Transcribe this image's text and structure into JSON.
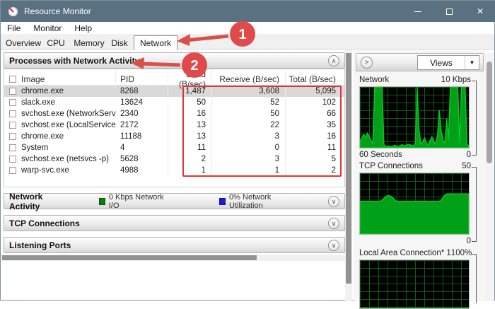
{
  "window": {
    "title": "Resource Monitor",
    "close_label": "✕"
  },
  "menu": {
    "items": [
      "File",
      "Monitor",
      "Help"
    ]
  },
  "tabs": {
    "items": [
      "Overview",
      "CPU",
      "Memory",
      "Disk",
      "Network"
    ],
    "active": "Network"
  },
  "processes_panel": {
    "title": "Processes with Network Activity",
    "collapse_icon": "∧",
    "columns": {
      "image": "Image",
      "pid": "PID",
      "send": "Send (B/sec)",
      "receive": "Receive (B/sec)",
      "total": "Total (B/sec)"
    },
    "rows": [
      {
        "image": "chrome.exe",
        "pid": "8268",
        "send": "1,487",
        "receive": "3,608",
        "total": "5,095",
        "selected": true
      },
      {
        "image": "slack.exe",
        "pid": "13624",
        "send": "50",
        "receive": "52",
        "total": "102",
        "selected": false
      },
      {
        "image": "svchost.exe (NetworkService -p)",
        "pid": "2340",
        "send": "16",
        "receive": "50",
        "total": "66",
        "selected": false
      },
      {
        "image": "svchost.exe (LocalServiceNetwo...",
        "pid": "2172",
        "send": "13",
        "receive": "22",
        "total": "35",
        "selected": false
      },
      {
        "image": "chrome.exe",
        "pid": "11188",
        "send": "13",
        "receive": "3",
        "total": "16",
        "selected": false
      },
      {
        "image": "System",
        "pid": "4",
        "send": "11",
        "receive": "0",
        "total": "11",
        "selected": false
      },
      {
        "image": "svchost.exe (netsvcs -p)",
        "pid": "5628",
        "send": "2",
        "receive": "3",
        "total": "5",
        "selected": false
      },
      {
        "image": "warp-svc.exe",
        "pid": "4988",
        "send": "1",
        "receive": "1",
        "total": "2",
        "selected": false
      }
    ]
  },
  "network_activity": {
    "title": "Network Activity",
    "expand_icon": "∨",
    "legend": [
      {
        "label": "0 Kbps Network I/O",
        "color": "#0e7a0e"
      },
      {
        "label": "0% Network Utilization",
        "color": "#1b1bd1"
      }
    ]
  },
  "collapsed_panels": [
    {
      "title": "TCP Connections",
      "expand_icon": "∨"
    },
    {
      "title": "Listening Ports",
      "expand_icon": "∨"
    }
  ],
  "sidebar": {
    "expand_icon": ">",
    "views_label": "Views",
    "views_drop_icon": "▼",
    "graph_colors": {
      "fill": "#00a018",
      "line": "#00d020",
      "grid": "#0d5f0d",
      "bg": "#000000"
    },
    "graphs": [
      {
        "name": "Network",
        "scale_top": "10 Kbps",
        "bottom_left": "60 Seconds",
        "bottom_right": "0",
        "series": [
          10,
          16,
          22,
          17,
          24,
          19,
          12,
          8,
          100,
          100,
          100,
          100,
          100,
          5,
          3,
          2,
          3,
          2,
          3,
          4,
          3,
          2,
          4,
          5,
          3,
          4,
          6,
          5,
          4,
          3,
          8,
          100,
          30,
          6,
          10,
          16,
          8,
          5,
          12,
          18,
          10,
          6,
          20,
          62,
          28,
          12,
          8,
          48,
          14,
          100,
          100,
          100,
          100,
          100,
          8,
          100,
          100,
          100,
          6,
          3
        ]
      },
      {
        "name": "TCP Connections",
        "scale_top": "50",
        "bottom_left": "",
        "bottom_right": "0",
        "series": [
          54,
          54,
          54,
          54,
          54,
          54,
          54,
          54,
          54,
          54,
          54,
          54,
          56,
          59,
          62,
          63,
          63,
          62,
          59,
          56,
          54,
          54,
          54,
          54,
          54,
          54,
          54,
          54,
          54,
          54,
          54,
          54,
          54,
          54,
          54,
          54,
          54,
          54,
          54,
          54,
          54,
          54,
          54,
          54,
          56,
          60,
          64,
          66,
          66,
          66,
          66,
          66,
          66,
          66,
          66,
          66,
          66,
          66,
          66,
          66
        ]
      },
      {
        "name": "Local Area Connection* 1",
        "scale_top": "100%",
        "bottom_left": "",
        "bottom_right": "",
        "series": [
          0,
          0,
          0,
          0,
          0,
          0,
          0,
          0,
          0,
          0,
          0,
          0
        ]
      }
    ]
  },
  "annotations": {
    "step1": "1",
    "step2": "2",
    "accent": "#e04a4a"
  }
}
